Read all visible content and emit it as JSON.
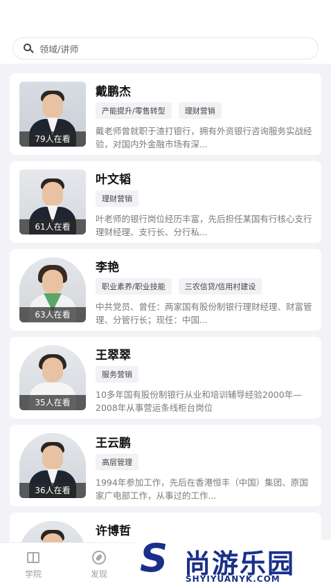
{
  "search": {
    "placeholder": "领域/讲师"
  },
  "lecturers": [
    {
      "name": "戴鹏杰",
      "viewers": "79人在看",
      "tags": [
        "产能提升/零售转型",
        "理财营销"
      ],
      "desc": "戴老师曾就职于渣打银行，拥有外资银行咨询服务实战经验，对国内外金融市场有深..."
    },
    {
      "name": "叶文韬",
      "viewers": "61人在看",
      "tags": [
        "理财营销"
      ],
      "desc": "叶老师的银行岗位经历丰富，先后担任某国有行核心支行理财经理、支行长、分行私..."
    },
    {
      "name": "李艳",
      "viewers": "63人在看",
      "tags": [
        "职业素养/职业技能",
        "三农信贷/信用村建设"
      ],
      "desc": "中共党员、曾任：两家国有股份制银行理财经理、财富管理、分管行长；现任：中国..."
    },
    {
      "name": "王翠翠",
      "viewers": "35人在看",
      "tags": [
        "服务营销"
      ],
      "desc": "10多年国有股份制银行从业和培训辅导经验2000年—2008年从事营运条线柜台岗位"
    },
    {
      "name": "王云鹏",
      "viewers": "36人在看",
      "tags": [
        "高层管理"
      ],
      "desc": "1994年参加工作，先后在香港恒丰（中国）集团、原国家广电部工作，从事过的工作..."
    },
    {
      "name": "许博哲",
      "viewers": "",
      "tags": [],
      "desc": ""
    }
  ],
  "tabbar": {
    "tab1": "学院",
    "tab2": "发现"
  },
  "watermark": {
    "text": "尚游乐园",
    "url": "SHYIYUANYK.COM",
    "color": "#1a2f8a"
  }
}
